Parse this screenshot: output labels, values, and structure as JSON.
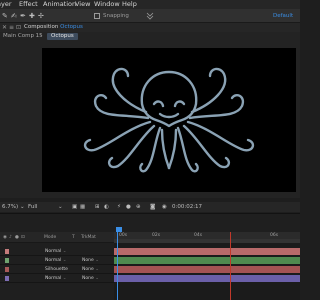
{
  "menubar": {
    "items": [
      "ayer",
      "Effect",
      "Animation",
      "View",
      "Window",
      "Help"
    ]
  },
  "toolbar": {
    "tools": [
      {
        "name": "puppet-pin-tool",
        "glyph": "✎"
      },
      {
        "name": "brush-tool",
        "glyph": "✍"
      },
      {
        "name": "roto-brush-tool",
        "glyph": "✒"
      },
      {
        "name": "pin-tool",
        "glyph": "✚"
      },
      {
        "name": "transform-tool",
        "glyph": "✢"
      }
    ],
    "snapping_label": "Snapping",
    "workspace_label": "Default"
  },
  "comp_panel": {
    "prefix": "Composition",
    "comp_name": "Octopus"
  },
  "breadcrumbs": {
    "parent": "Main Comp 15",
    "current": "Octopus"
  },
  "viewer_controls": {
    "zoom": "6.7%)",
    "resolution": "Full",
    "timecode": "0:00:02:17"
  },
  "timeline": {
    "column_headers": {
      "mode": "Mode",
      "t": "T",
      "trkmat": "TrkMat"
    },
    "ruler_labels": [
      "00s",
      "02s",
      "04s",
      "06s"
    ],
    "rows": [
      {
        "mode": "Normal",
        "track": "",
        "color": "#c47b7b",
        "bar_color": "#b86a6a"
      },
      {
        "mode": "Normal",
        "track": "None",
        "color": "#6fa36f",
        "bar_color": "#4f8a4f"
      },
      {
        "mode": "Silhouette",
        "track": "None",
        "color": "#a85a5a",
        "bar_color": "#a45353"
      },
      {
        "mode": "Normal",
        "track": "None",
        "color": "#7d6db3",
        "bar_color": "#6b5fa8"
      }
    ]
  },
  "colors": {
    "accent": "#3a8ee6",
    "canvas": "#000000",
    "octopus_stroke": "#8aa2b4",
    "marker": "#c0392b"
  }
}
